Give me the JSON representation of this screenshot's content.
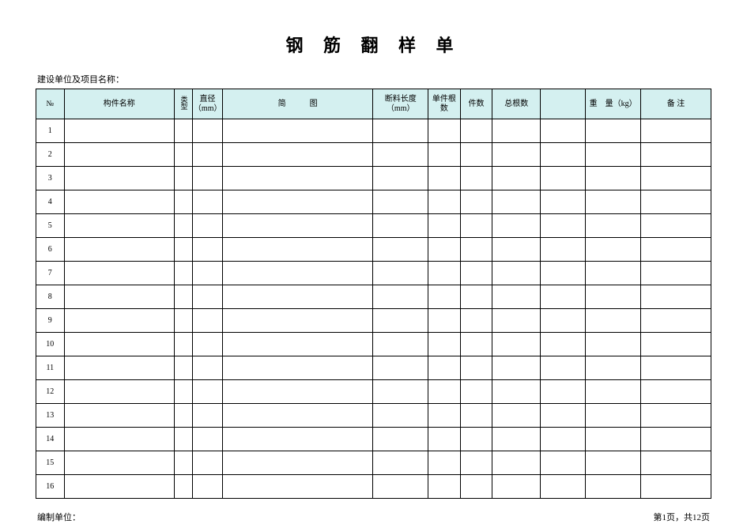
{
  "title": "钢 筋 翻 样 单",
  "subtitle": "建设单位及项目名称：",
  "headers": {
    "no": "№",
    "name": "构件名称",
    "type": "类型",
    "diameter": "直径（mm）",
    "diagram": "简　　　图",
    "cut_length": "断料长度（mm）",
    "unit_roots": "单件根数",
    "pieces": "件数",
    "total_roots": "总根数",
    "blank": "",
    "weight": "重　量（kg）",
    "note": "备 注"
  },
  "rows": [
    {
      "no": "1"
    },
    {
      "no": "2"
    },
    {
      "no": "3"
    },
    {
      "no": "4"
    },
    {
      "no": "5"
    },
    {
      "no": "6"
    },
    {
      "no": "7"
    },
    {
      "no": "8"
    },
    {
      "no": "9"
    },
    {
      "no": "10"
    },
    {
      "no": "11"
    },
    {
      "no": "12"
    },
    {
      "no": "13"
    },
    {
      "no": "14"
    },
    {
      "no": "15"
    },
    {
      "no": "16"
    }
  ],
  "footer_left": "编制单位：",
  "footer_right": "第1页，共12页"
}
